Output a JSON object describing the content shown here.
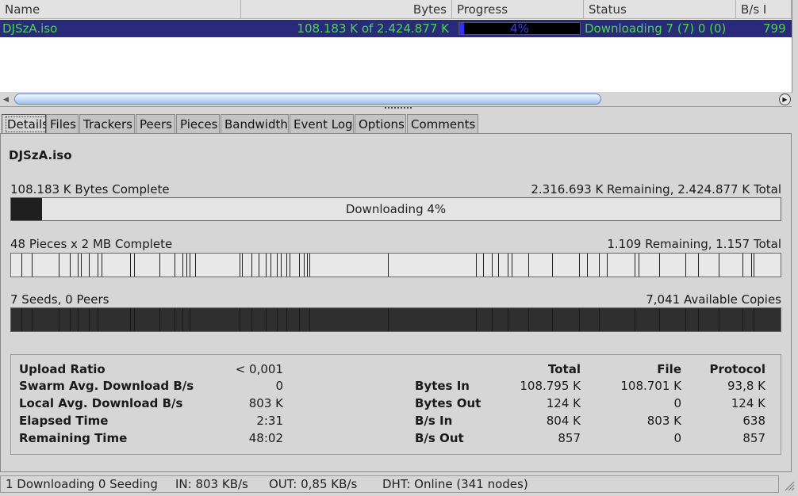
{
  "list": {
    "columns": [
      "Name",
      "Bytes",
      "Progress",
      "Status",
      "B/s I"
    ],
    "rows": [
      {
        "name": "DJSzA.iso",
        "bytes": "108.183 K of 2.424.877 K",
        "progress_text": "4%",
        "progress": 0.04,
        "status": "Downloading 7 (7) 0 (0)",
        "rate": "799"
      }
    ]
  },
  "tabs": [
    "Details",
    "Files",
    "Trackers",
    "Peers",
    "Pieces",
    "Bandwidth",
    "Event Log",
    "Options",
    "Comments"
  ],
  "active_tab": "Details",
  "details": {
    "filename": "DJSzA.iso",
    "bytes_complete": "108.183 K Bytes Complete",
    "bytes_remaining_total": "2.316.693 K Remaining,  2.424.877 K Total",
    "download_label": "Downloading 4%",
    "download_progress": 0.04,
    "pieces_complete": "48 Pieces  x  2 MB Complete",
    "pieces_remaining_total": "1.109 Remaining,  1.157 Total",
    "seeds_peers": "7 Seeds, 0 Peers",
    "available_copies": "7,041 Available Copies"
  },
  "stats": {
    "left": [
      {
        "label": "Upload Ratio",
        "value": "< 0,001"
      },
      {
        "label": "Swarm Avg. Download B/s",
        "value": "0"
      },
      {
        "label": "Local Avg. Download B/s",
        "value": "803 K"
      },
      {
        "label": "Elapsed Time",
        "value": "2:31"
      },
      {
        "label": "Remaining Time",
        "value": "48:02"
      }
    ],
    "right_headers": [
      "Total",
      "File",
      "Protocol"
    ],
    "right": [
      {
        "label": "Bytes In",
        "total": "108.795 K",
        "file": "108.701 K",
        "protocol": "93,8 K"
      },
      {
        "label": "Bytes Out",
        "total": "124 K",
        "file": "0",
        "protocol": "124 K"
      },
      {
        "label": "B/s In",
        "total": "804 K",
        "file": "803 K",
        "protocol": "638"
      },
      {
        "label": "B/s Out",
        "total": "857",
        "file": "0",
        "protocol": "857"
      }
    ]
  },
  "statusbar": {
    "downloading": "1 Downloading  0 Seeding",
    "in": "IN: 803 KB/s",
    "out": "OUT: 0,85 KB/s",
    "dht": "DHT: Online (341 nodes)"
  },
  "icons": {
    "scroll_left": "left-arrow-icon",
    "scroll_right": "right-arrow-icon",
    "grip": "resize-grip-icon"
  },
  "colors": {
    "row_selected_bg": "#2a2a7a",
    "row_text": "#4ad84a",
    "progress_fill": "#3030ff"
  }
}
